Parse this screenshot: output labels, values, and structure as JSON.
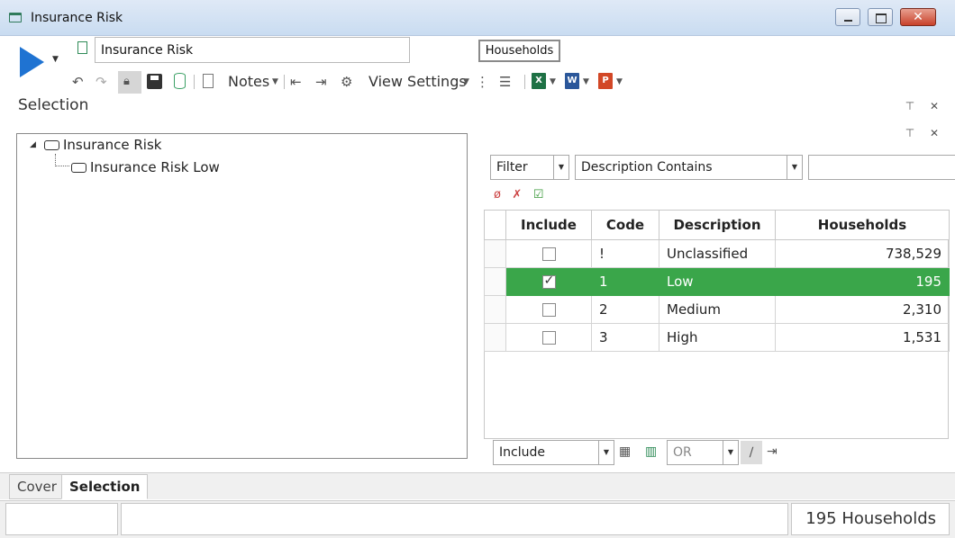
{
  "window": {
    "title": "Insurance Risk"
  },
  "toolbar": {
    "name_value": "Insurance Risk",
    "households_label": "Households",
    "notes_label": "Notes",
    "view_settings_label": "View Settings",
    "excel_letter": "X",
    "word_letter": "W",
    "ppt_letter": "P"
  },
  "section": {
    "title": "Selection"
  },
  "tree": {
    "root": "Insurance Risk",
    "child": "Insurance Risk Low"
  },
  "filter": {
    "mode": "Filter",
    "operator": "Description Contains",
    "text": ""
  },
  "grid": {
    "headers": {
      "include": "Include",
      "code": "Code",
      "description": "Description",
      "households": "Households"
    },
    "rows": [
      {
        "include": false,
        "code": "!",
        "description": "Unclassified",
        "households": "738,529"
      },
      {
        "include": true,
        "code": "1",
        "description": "Low",
        "households": "195"
      },
      {
        "include": false,
        "code": "2",
        "description": "Medium",
        "households": "2,310"
      },
      {
        "include": false,
        "code": "3",
        "description": "High",
        "households": "1,531"
      }
    ]
  },
  "bottom_bar": {
    "include_value": "Include",
    "logic_value": "OR"
  },
  "tabs": [
    {
      "label": "Cover"
    },
    {
      "label": "Selection",
      "active": true
    }
  ],
  "status": {
    "count_text": "195 Households"
  },
  "colors": {
    "selected_row": "#3aa64a",
    "run_button": "#1f73d2",
    "accent_green": "#2e8b57"
  },
  "icons": [
    "app-icon",
    "run-icon",
    "undo-icon",
    "redo-icon",
    "lock-icon",
    "save-icon",
    "database-icon",
    "clipboard-icon",
    "indent-icon",
    "outdent-icon",
    "settings-icon",
    "hierarchy-icon",
    "table-icon",
    "excel-icon",
    "word-icon",
    "powerpoint-icon",
    "pin-icon",
    "close-icon"
  ]
}
